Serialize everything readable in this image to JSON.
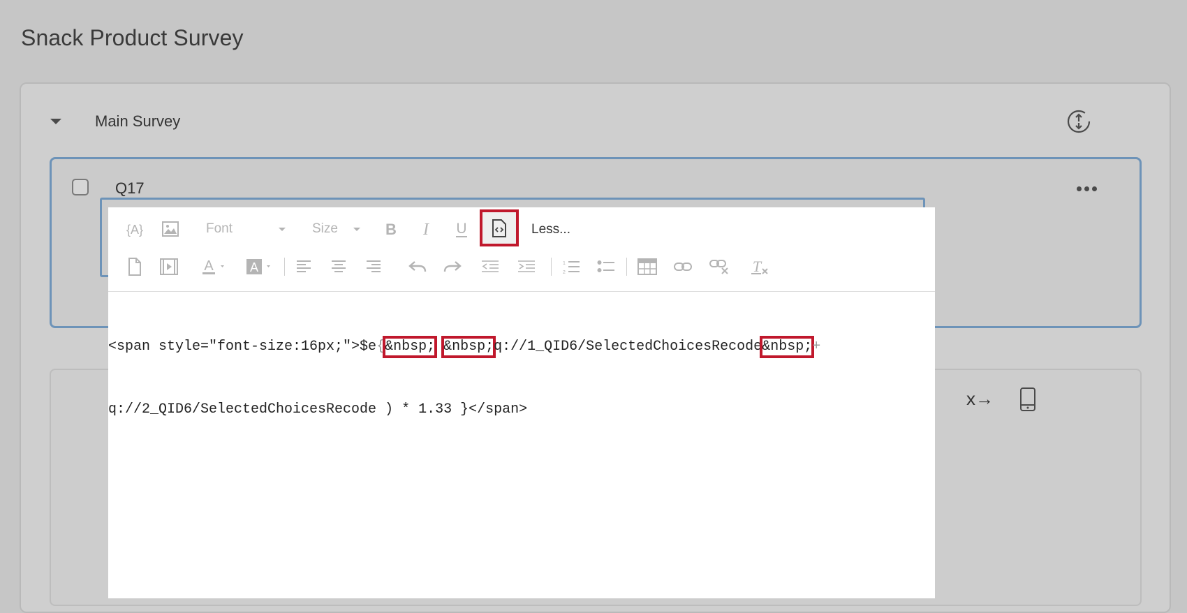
{
  "page_title": "Snack Product Survey",
  "block": {
    "title": "Main Survey"
  },
  "question": {
    "label": "Q17"
  },
  "editor": {
    "toolbar": {
      "font_label": "Font",
      "size_label": "Size",
      "less_label": "Less..."
    },
    "code": {
      "line1_a": "<span style=\"font-size:16px;\">$e",
      "line1_b": "{",
      "nbsp1": "&nbsp;",
      "nbsp2": "&nbsp;",
      "line1_c": "q://1_QID6/SelectedChoicesRecode",
      "nbsp3": "&nbsp;",
      "line1_d": "+",
      "line2": "q://2_QID6/SelectedChoicesRecode ) * 1.33 }</span>"
    }
  },
  "colors": {
    "highlight": "#c0182c",
    "question_border": "#6d93b8"
  },
  "icons": {
    "piped_text": "piped-text-icon",
    "image": "image-icon",
    "bold": "bold-icon",
    "italic": "italic-icon",
    "underline": "underline-icon",
    "source": "source-code-icon",
    "file": "file-icon",
    "video": "video-icon",
    "text_color": "text-color-icon",
    "background_color": "background-color-icon",
    "align_left": "align-left-icon",
    "align_center": "align-center-icon",
    "align_right": "align-right-icon",
    "undo": "undo-icon",
    "redo": "redo-icon",
    "outdent": "outdent-icon",
    "indent": "indent-icon",
    "numbered_list": "numbered-list-icon",
    "bullet_list": "bullet-list-icon",
    "table": "table-icon",
    "link": "link-icon",
    "unlink": "unlink-icon",
    "clear_format": "clear-format-icon",
    "refresh": "refresh-icon",
    "more": "more-icon",
    "phone": "phone-icon"
  }
}
